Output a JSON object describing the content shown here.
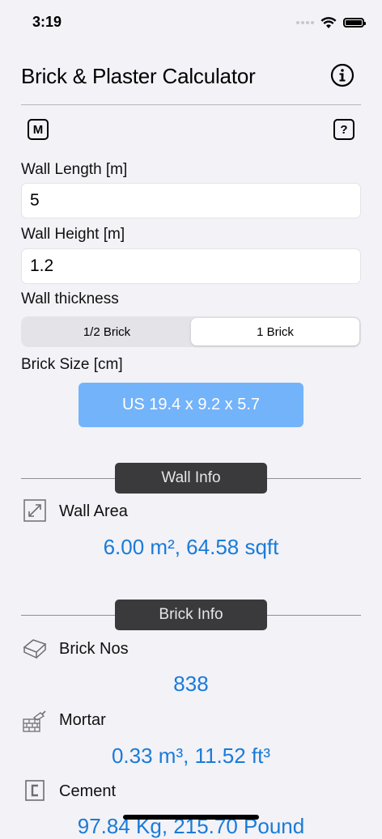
{
  "status": {
    "time": "3:19"
  },
  "app": {
    "title": "Brick & Plaster Calculator",
    "m_label": "M",
    "help_label": "?"
  },
  "inputs": {
    "length": {
      "label": "Wall Length [m]",
      "value": "5"
    },
    "height": {
      "label": "Wall Height [m]",
      "value": "1.2"
    }
  },
  "thickness": {
    "label": "Wall thickness",
    "options": [
      "1/2 Brick",
      "1 Brick"
    ],
    "selected": "1 Brick"
  },
  "brick_size": {
    "label": "Brick Size [cm]",
    "button": "US 19.4 x 9.2 x 5.7"
  },
  "wall_info": {
    "header": "Wall Info",
    "area_label": "Wall Area",
    "area_value": "6.00 m², 64.58 sqft"
  },
  "brick_info": {
    "header": "Brick Info",
    "nos_label": "Brick Nos",
    "nos_value": "838",
    "mortar_label": "Mortar",
    "mortar_value": "0.33 m³, 11.52 ft³",
    "cement_label": "Cement",
    "cement_value": "97.84 Kg, 215.70 Pound"
  },
  "colors": {
    "accent": "#1a7bd8",
    "button": "#73b3fa",
    "pill": "#3a3a3c",
    "background": "#f2f2f7"
  }
}
